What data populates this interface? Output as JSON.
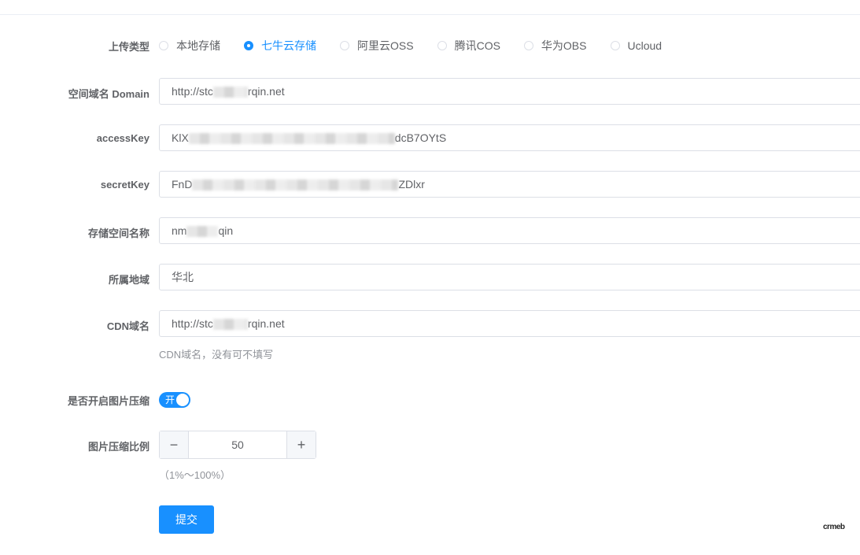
{
  "form": {
    "upload_type": {
      "label": "上传类型",
      "options": [
        "本地存储",
        "七牛云存储",
        "阿里云OSS",
        "腾讯COS",
        "华为OBS",
        "Ucloud"
      ],
      "selected": "七牛云存储"
    },
    "domain": {
      "label": "空间域名 Domain",
      "value_prefix": "http://stc",
      "value_suffix": "rqin.net"
    },
    "access_key": {
      "label": "accessKey",
      "value_prefix": "KlX",
      "value_suffix": "dcB7OYtS"
    },
    "secret_key": {
      "label": "secretKey",
      "value_prefix": "FnD",
      "value_suffix": "ZDlxr"
    },
    "bucket": {
      "label": "存储空间名称",
      "value_prefix": "nm",
      "value_suffix": "qin"
    },
    "region": {
      "label": "所属地域",
      "value": "华北"
    },
    "cdn_domain": {
      "label": "CDN域名",
      "value_prefix": "http://stc",
      "value_suffix": "rqin.net",
      "help": "CDN域名，没有可不填写"
    },
    "compress": {
      "label": "是否开启图片压缩",
      "switch_text": "开",
      "enabled": true
    },
    "compress_ratio": {
      "label": "图片压缩比例",
      "value": "50",
      "minus": "−",
      "plus": "+",
      "help": "（1%～100%）"
    },
    "submit_label": "提交"
  },
  "watermark": "crmeb",
  "colors": {
    "accent": "#1890ff",
    "border": "#dcdfe6",
    "text": "#606266",
    "muted": "#909399"
  }
}
